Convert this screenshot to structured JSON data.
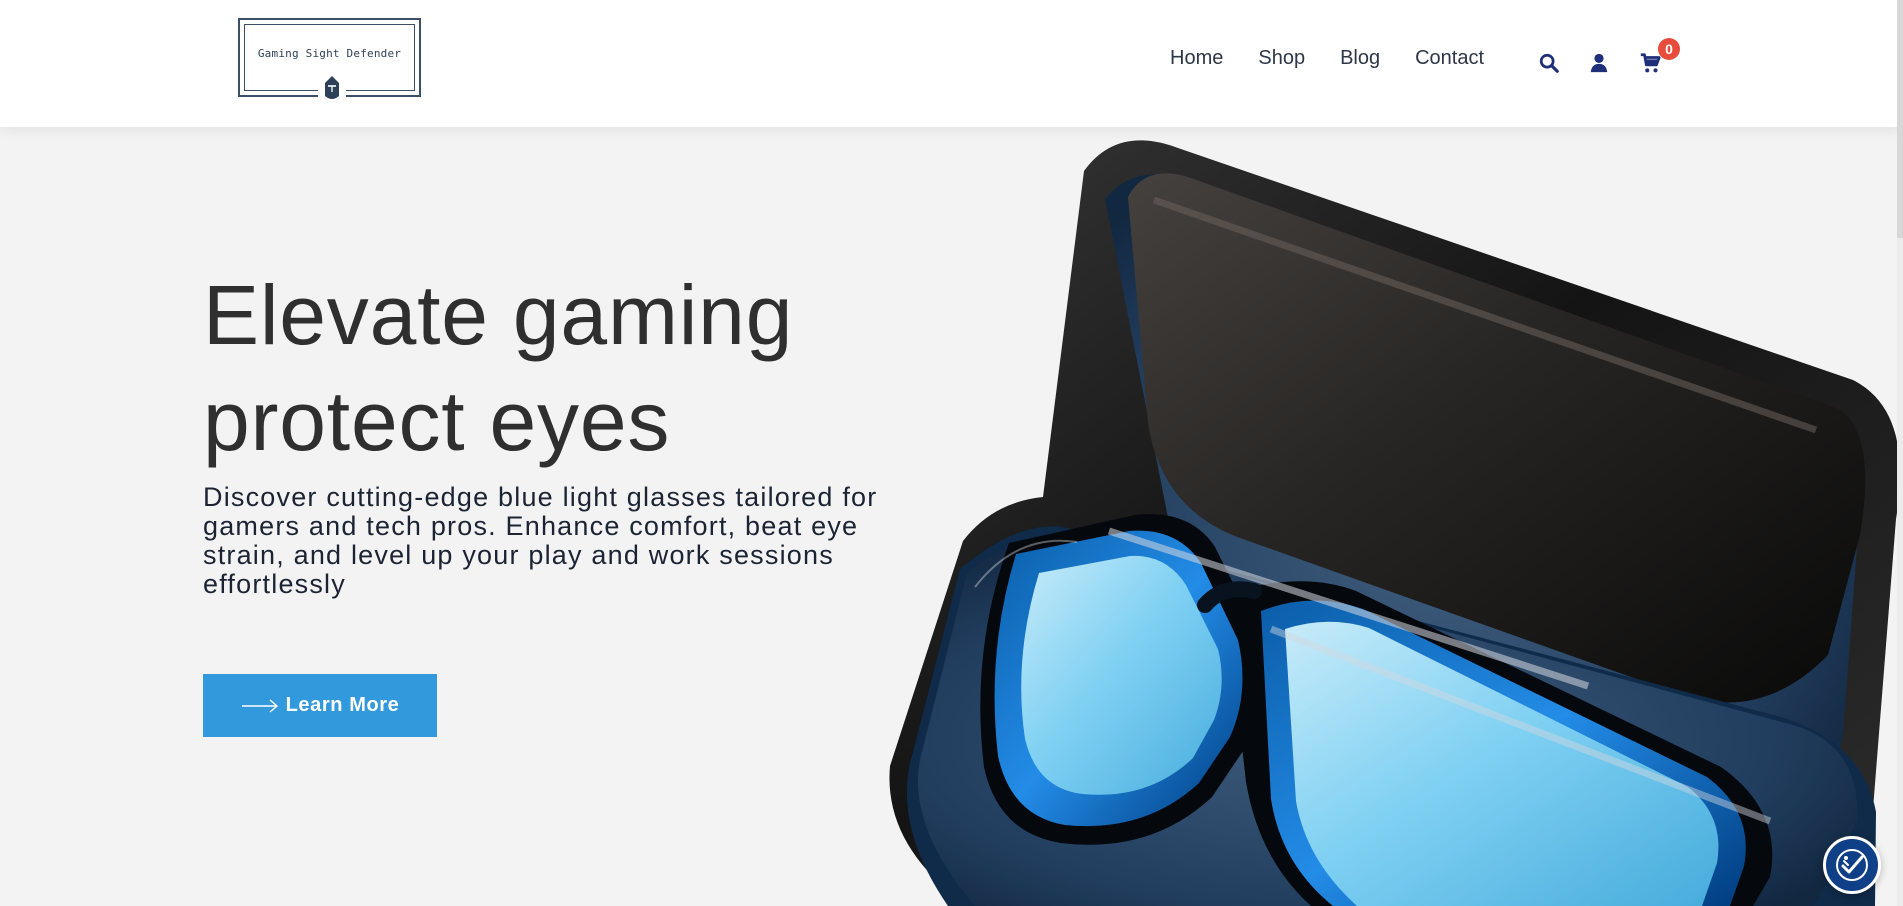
{
  "brand": {
    "logo_text": "Gaming Sight Defender",
    "colors": {
      "primary": "#3399dd",
      "navy": "#1f2f7a",
      "badge_red": "#e74c3c"
    }
  },
  "nav": {
    "items": [
      {
        "label": "Home"
      },
      {
        "label": "Shop"
      },
      {
        "label": "Blog"
      },
      {
        "label": "Contact"
      }
    ],
    "icons": {
      "search": "search-icon",
      "account": "user-icon",
      "cart": "cart-icon"
    },
    "cart_count": "0"
  },
  "hero": {
    "title": "Elevate gaming\nprotect eyes",
    "description": "Discover cutting-edge blue light glasses tailored for gamers and tech pros. Enhance comfort, beat eye strain, and level up your play and work sessions effortlessly",
    "cta_label": "Learn More",
    "image_name": "blue-light-glasses-case"
  },
  "widgets": {
    "accessibility_icon": "accessibility-icon"
  }
}
